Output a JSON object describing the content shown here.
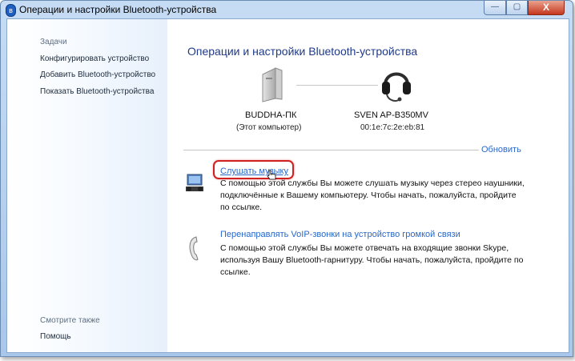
{
  "window": {
    "title": "Операции и настройки Bluetooth-устройства",
    "controls": {
      "minimize": "—",
      "maximize": "▢",
      "close": "X"
    }
  },
  "sidebar": {
    "tasks_heading": "Задачи",
    "tasks": [
      "Конфигурировать устройство",
      "Добавить Bluetooth-устройство",
      "Показать Bluetooth-устройства"
    ],
    "see_also_heading": "Смотрите также",
    "see_also": [
      "Помощь"
    ]
  },
  "main": {
    "title": "Операции и настройки Bluetooth-устройства",
    "computer": {
      "name": "BUDDHA-ПК",
      "sub": "(Этот компьютер)"
    },
    "device": {
      "name": "SVEN AP-B350MV",
      "sub": "00:1e:7c:2e:eb:81"
    },
    "refresh": "Обновить",
    "services": [
      {
        "link": "Слушать музыку",
        "desc": "С помощью этой службы Вы можете слушать музыку через стерео наушники, подключённые к Вашему компьютеру. Чтобы начать, пожалуйста, пройдите по ссылке."
      },
      {
        "link": "Перенаправлять VoIP-звонки на устройство громкой связи",
        "desc": "С помощью этой службы Вы можете отвечать на входящие звонки Skype, используя Вашу Bluetooth-гарнитуру. Чтобы начать, пожалуйста, пройдите по ссылке."
      }
    ]
  },
  "colors": {
    "link": "#2867c8",
    "highlight": "#d02020",
    "title": "#1e3a8a"
  }
}
